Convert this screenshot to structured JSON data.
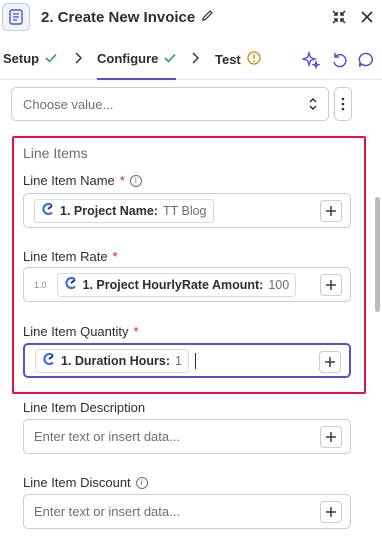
{
  "header": {
    "title": "2. Create New Invoice",
    "app_icon": "invoice-app-icon",
    "edit_icon": "pencil-icon",
    "collapse_icon": "collapse-arrows-icon",
    "close_icon": "close-icon"
  },
  "tabs": [
    {
      "label": "Setup",
      "status": "complete"
    },
    {
      "label": "Configure",
      "status": "complete",
      "active": true
    },
    {
      "label": "Test",
      "status": "warning"
    }
  ],
  "toolbar": {
    "ai_icon": "sparkle-icon",
    "reset_icon": "undo-icon",
    "comment_icon": "comment-icon"
  },
  "above_field": {
    "placeholder": "Choose value..."
  },
  "group": {
    "title": "Line Items"
  },
  "fields": [
    {
      "label": "Line Item Name",
      "required": true,
      "info": true,
      "chip_label": "1. Project Name:",
      "chip_value": "TT Blog"
    },
    {
      "label": "Line Item Rate",
      "required": true,
      "info": false,
      "prefix": "1.0",
      "chip_label": "1. Project HourlyRate Amount:",
      "chip_value": "100"
    },
    {
      "label": "Line Item Quantity",
      "required": true,
      "info": false,
      "chip_label": "1. Duration Hours:",
      "chip_value": "1"
    },
    {
      "label": "Line Item Description",
      "required": false,
      "info": false,
      "placeholder": "Enter text or insert data..."
    },
    {
      "label": "Line Item Discount",
      "required": false,
      "info": true,
      "placeholder": "Enter text or insert data..."
    }
  ],
  "colors": {
    "accent": "#5b4cd6",
    "success": "#21a366",
    "warning": "#c98a0a",
    "highlight": "#e0143c",
    "chip_logo": "#3b6ff2"
  }
}
